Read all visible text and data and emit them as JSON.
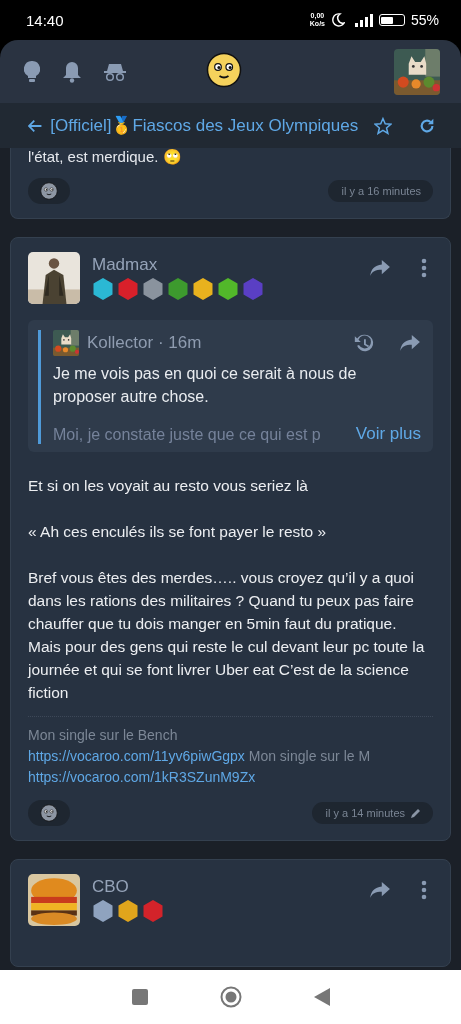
{
  "status_bar": {
    "time": "14:40",
    "net_speed": "0,00",
    "net_unit": "Ko/s",
    "battery": "55%"
  },
  "topic": {
    "title": "[Officiel]🥇Fiascos des Jeux Olympiques",
    "starred": false
  },
  "posts": [
    {
      "kind": "tail",
      "text": "l'état, est merdique. 🙄",
      "time": "il y a 16 minutes",
      "edited": false
    },
    {
      "kind": "full",
      "author": "Madmax",
      "badges": [
        {
          "color": "#2bb8d4"
        },
        {
          "color": "#d8202a"
        },
        {
          "color": "#8a939e"
        },
        {
          "color": "#3d9a2e"
        },
        {
          "color": "#e8b21e"
        },
        {
          "color": "#52b82a"
        },
        {
          "color": "#5a3fc4"
        }
      ],
      "quote": {
        "author": "Kollector",
        "separator": "·",
        "age": "16m",
        "text": "Je me vois pas en quoi ce serait à nous de proposer autre chose.",
        "faded_text": "Moi, je constate juste que ce qui est p",
        "more": "Voir plus"
      },
      "paragraphs": [
        "Et si on les voyait au resto vous seriez là",
        "« Ah ces enculés ils se font payer le resto »",
        "Bref vous êtes des merdes….. vous croyez qu’il y a quoi dans les rations des militaires ? Quand tu peux pas faire chauffer que tu dois manger en 5min faut du pratique. Mais pour des gens qui reste le cul devant leur pc toute la journée et qui se font livrer Uber eat C’est de la science fiction"
      ],
      "signature": [
        [
          {
            "kind": "text",
            "text": "Mon single sur le Bench"
          }
        ],
        [
          {
            "kind": "link",
            "text": "https://vocaroo.com/11yv6piwGgpx"
          },
          {
            "kind": "text",
            "text": "Mon single sur le M"
          }
        ],
        [
          {
            "kind": "link",
            "text": "https://vocaroo.com/1kR3SZunM9Zx"
          }
        ]
      ],
      "time": "il y a 14 minutes",
      "edited": true
    },
    {
      "kind": "head",
      "author": "CBO",
      "badges": [
        {
          "color": "#8fa3bf"
        },
        {
          "color": "#e0a51c"
        },
        {
          "color": "#d3232a"
        }
      ]
    }
  ]
}
